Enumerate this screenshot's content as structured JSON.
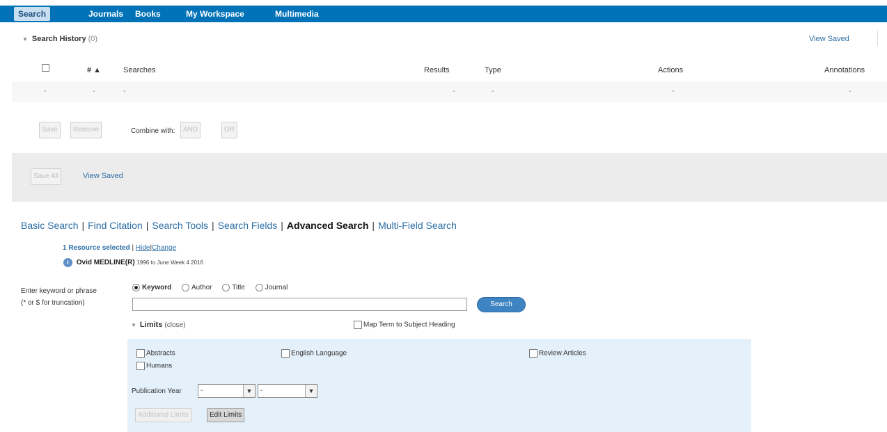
{
  "nav": {
    "tabs": [
      "Search",
      "Journals",
      "Books",
      "My Workspace",
      "Multimedia"
    ],
    "active_tab": "Search"
  },
  "history": {
    "title": "Search History",
    "count": "(0)",
    "view_saved": "View Saved",
    "columns": [
      "# ▲",
      "Searches",
      "Results",
      "Type",
      "Actions",
      "Annotations"
    ],
    "empty_row": [
      "-",
      "-",
      "-",
      "-",
      "-",
      "-",
      "-"
    ],
    "buttons": {
      "save": "Save",
      "remove": "Remove",
      "and": "AND",
      "or": "OR",
      "save_all": "Save All"
    },
    "combine_label": "Combine with:",
    "view_saved_bottom": "View Saved"
  },
  "modes": {
    "items": [
      "Basic Search",
      "Find Citation",
      "Search Tools",
      "Search Fields",
      "Advanced Search",
      "Multi-Field Search"
    ],
    "active": "Advanced Search"
  },
  "resources": {
    "selected": "1 Resource selected",
    "sep": "|",
    "hide": "Hide",
    "change": "Change",
    "info_icon_glyph": "i",
    "db_name": "Ovid MEDLINE(R)",
    "db_range": "1996 to June Week 4 2016"
  },
  "search": {
    "label_line1": "Enter keyword or phrase",
    "label_line2": "(* or $ for truncation)",
    "radios": [
      "Keyword",
      "Author",
      "Title",
      "Journal"
    ],
    "selected_radio": "Keyword",
    "input_value": "",
    "button": "Search"
  },
  "limits": {
    "title": "Limits",
    "close": "(close)",
    "map_term": "Map Term to Subject Heading",
    "checkboxes": {
      "abstracts": "Abstracts",
      "english": "English Language",
      "review": "Review Articles",
      "humans": "Humans"
    },
    "pub_year_label": "Publication Year",
    "year_from": "-",
    "year_to": "-",
    "additional_limits": "Additional Limits",
    "edit_limits": "Edit Limits"
  },
  "colors": {
    "nav_bar": "#0072b8",
    "link": "#2c6ea6",
    "limits_bg": "#e4f0fa",
    "search_button": "#3f84c2"
  }
}
